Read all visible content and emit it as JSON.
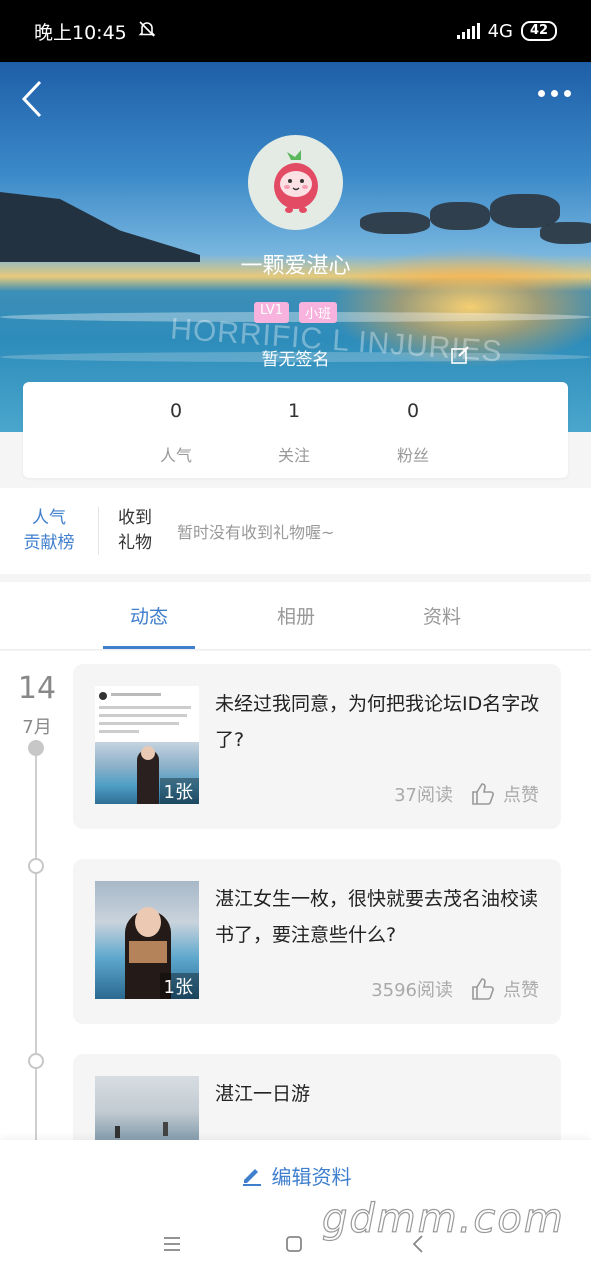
{
  "status_bar": {
    "time": "晚上10:45",
    "network": "4G",
    "battery": "42"
  },
  "profile": {
    "username": "一颗爱湛心",
    "level_badge": "LV1",
    "class_badge": "小班",
    "signature": "暂无签名",
    "background_watermark": "HORRIFIC L INJURIES"
  },
  "stats": [
    {
      "value": "0",
      "label": "人气"
    },
    {
      "value": "1",
      "label": "关注"
    },
    {
      "value": "0",
      "label": "粉丝"
    }
  ],
  "gifts": {
    "ranking_line1": "人气",
    "ranking_line2": "贡献榜",
    "received_line1": "收到",
    "received_line2": "礼物",
    "empty_text": "暂时没有收到礼物喔~"
  },
  "tabs": [
    {
      "label": "动态"
    },
    {
      "label": "相册"
    },
    {
      "label": "资料"
    }
  ],
  "active_tab": "动态",
  "timeline": {
    "day": "14",
    "month": "7月"
  },
  "posts": [
    {
      "title": "未经过我同意，为何把我论坛ID名字改了?",
      "pic_count": "1张",
      "reads": "37阅读",
      "like_label": "点赞"
    },
    {
      "title": "湛江女生一枚，很快就要去茂名油校读书了，要注意些什么?",
      "pic_count": "1张",
      "reads": "3596阅读",
      "like_label": "点赞"
    },
    {
      "title": "湛江一日游",
      "pic_count": "",
      "reads": "",
      "like_label": ""
    }
  ],
  "bottom_action": {
    "label": "编辑资料"
  },
  "site_watermark": "gdmm.com",
  "colors": {
    "accent": "#3f7fce",
    "badge_pink": "#f7b3dd"
  }
}
